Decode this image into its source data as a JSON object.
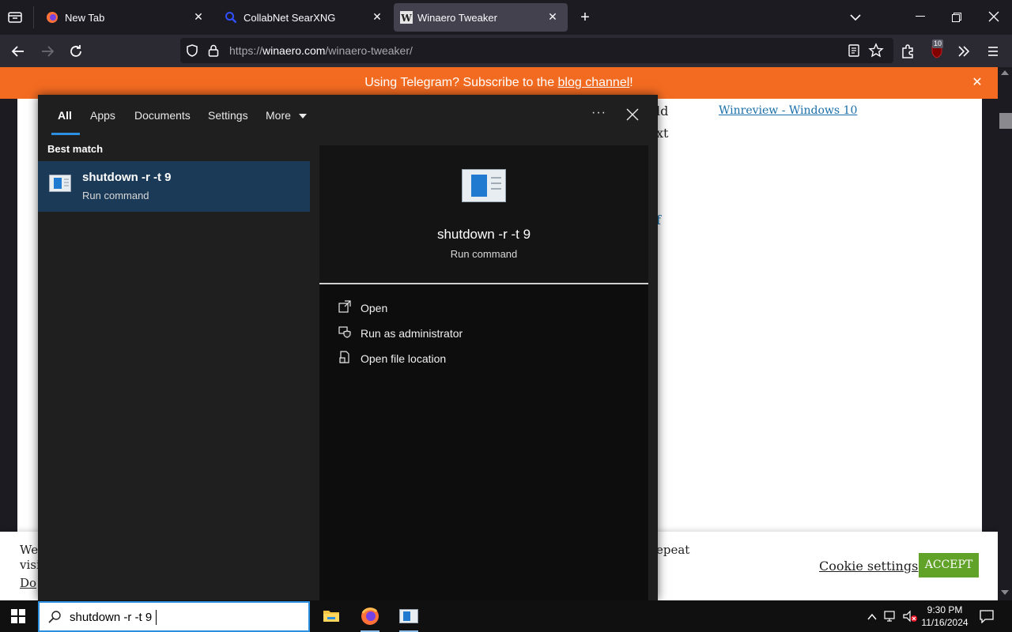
{
  "browser": {
    "tabs": [
      {
        "title": "New Tab",
        "icon": "firefox-icon",
        "active": false
      },
      {
        "title": "CollabNet SearXNG",
        "icon": "search-icon",
        "active": false
      },
      {
        "title": "Winaero Tweaker",
        "icon": "winaero-w-icon",
        "active": true
      }
    ],
    "url": {
      "prefix": "https://",
      "domain": "winaero.com",
      "path": "/winaero-tweaker/"
    },
    "extension_badge": "10"
  },
  "page": {
    "banner": {
      "text": "Using Telegram? Subscribe to the ",
      "link": "blog channel",
      "suffix": "!"
    },
    "sidebar_link": "Winreview - Windows 10",
    "partial_text": {
      "line1": "ld",
      "line2": "xt",
      "line3": "f"
    },
    "cookie": {
      "left_line1": "We",
      "left_line2": "visi",
      "left_line3": "Do",
      "right_text": "epeat",
      "settings_label": "Cookie settings",
      "accept_label": "ACCEPT"
    }
  },
  "start_search": {
    "tabs": [
      "All",
      "Apps",
      "Documents",
      "Settings",
      "More"
    ],
    "ellipsis": "···",
    "section_label": "Best match",
    "best_match": {
      "title": "shutdown -r -t 9",
      "subtitle": "Run command"
    },
    "preview": {
      "title": "shutdown -r -t 9",
      "subtitle": "Run command"
    },
    "actions": [
      {
        "label": "Open",
        "icon": "open-icon"
      },
      {
        "label": "Run as administrator",
        "icon": "shield-icon"
      },
      {
        "label": "Open file location",
        "icon": "file-location-icon"
      }
    ]
  },
  "taskbar": {
    "search_text": "shutdown -r -t 9",
    "time": "9:30 PM",
    "date": "11/16/2024"
  },
  "colors": {
    "accent": "#2d8fe0",
    "banner": "#f36b21",
    "accept": "#61a229",
    "selected_row": "#1b3a57"
  }
}
